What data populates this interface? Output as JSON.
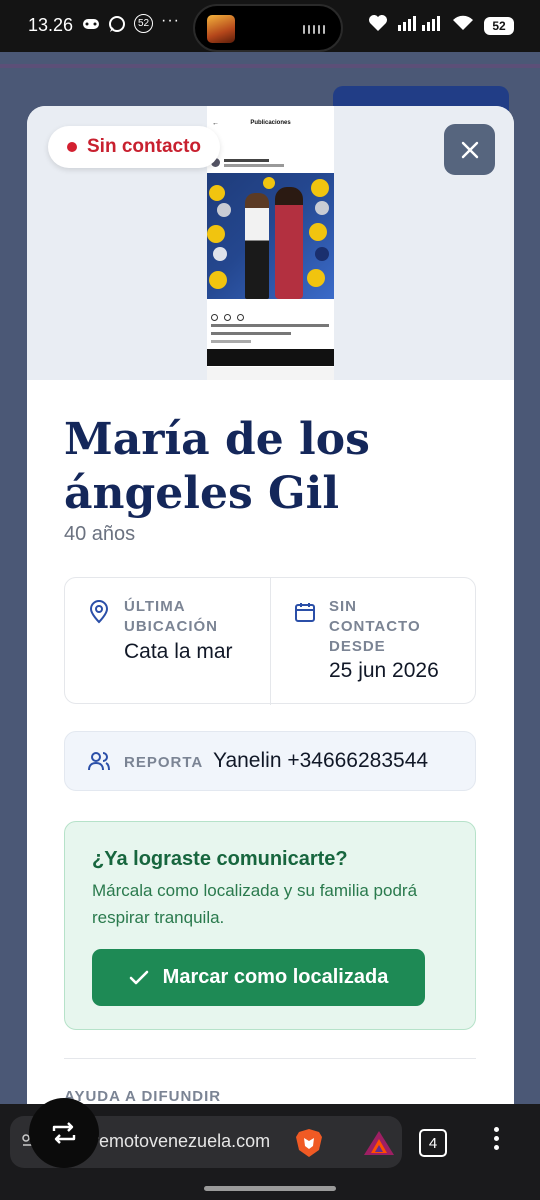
{
  "status_bar": {
    "time": "13.26",
    "notification_count": "52",
    "battery": "52"
  },
  "modal": {
    "status_pill": "Sin contacto",
    "name": "María de los ángeles Gil",
    "age": "40 años",
    "last_location": {
      "label": "ÚLTIMA UBICACIÓN",
      "value": "Cata la mar"
    },
    "no_contact_since": {
      "label": "SIN CONTACTO DESDE",
      "value": "25 jun 2026"
    },
    "report": {
      "label": "REPORTA",
      "value": "Yanelin +34666283544"
    },
    "found_card": {
      "title": "¿Ya lograste comunicarte?",
      "text": "Márcala como localizada y su familia podrá respirar tranquila.",
      "button": "Marcar como localizada"
    },
    "help_section": "AYUDA A DIFUNDIR"
  },
  "photo": {
    "header": "Publicaciones"
  },
  "browser": {
    "url": "terremotovenezuela.com",
    "tab_count": "4"
  },
  "colors": {
    "brand_navy": "#14275a",
    "danger_red": "#d32030",
    "success_green": "#1e8a55"
  }
}
